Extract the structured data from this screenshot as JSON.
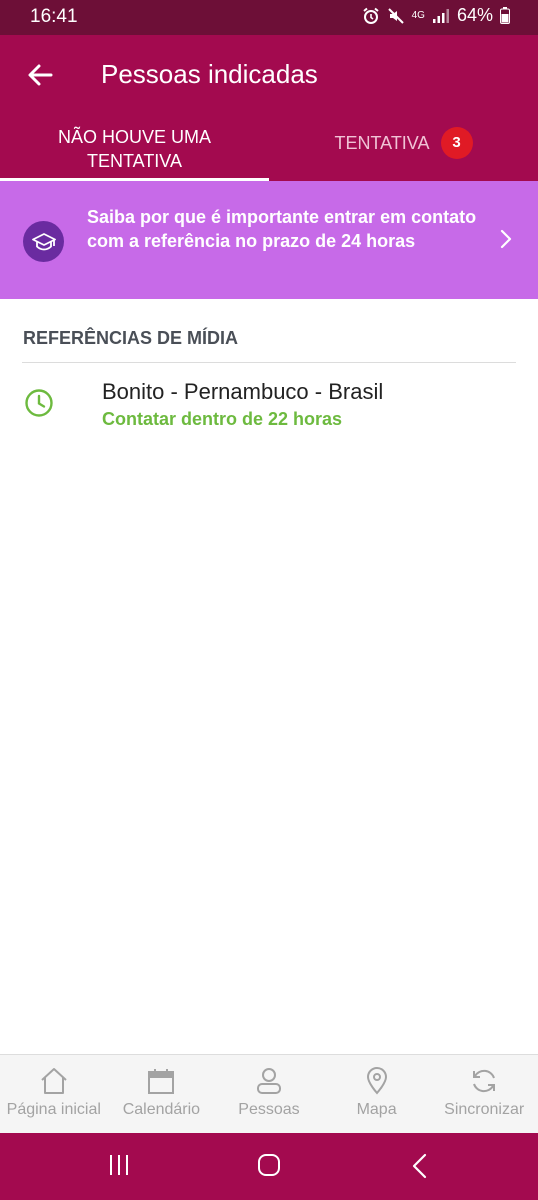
{
  "status_bar": {
    "time": "16:41",
    "network": "4G",
    "battery": "64%"
  },
  "app_bar": {
    "title": "Pessoas indicadas",
    "back_icon": "arrow-left-icon"
  },
  "tabs": [
    {
      "label": "NÃO HOUVE UMA TENTATIVA",
      "selected": true
    },
    {
      "label": "TENTATIVA",
      "badge": "3",
      "selected": false
    }
  ],
  "banner": {
    "text": "Saiba por que é importante entrar em contato com a referência no prazo de 24 horas",
    "icon": "graduation-cap-icon"
  },
  "section": {
    "header": "REFERÊNCIAS DE MÍDIA"
  },
  "items": [
    {
      "title": "Bonito - Pernambuco - Brasil",
      "subtitle": "Contatar dentro de 22 horas",
      "icon": "clock-icon"
    }
  ],
  "bottom_nav": [
    {
      "label": "Página inicial",
      "icon": "home-icon"
    },
    {
      "label": "Calendário",
      "icon": "calendar-icon"
    },
    {
      "label": "Pessoas",
      "icon": "person-icon"
    },
    {
      "label": "Mapa",
      "icon": "map-pin-icon"
    },
    {
      "label": "Sincronizar",
      "icon": "sync-icon"
    }
  ],
  "colors": {
    "primary": "#a30a4f",
    "status_bar": "#6d0f37",
    "banner": "#c76ae8",
    "banner_icon_bg": "#6a2ba0",
    "badge": "#e01a25",
    "success_text": "#6dba3f"
  }
}
